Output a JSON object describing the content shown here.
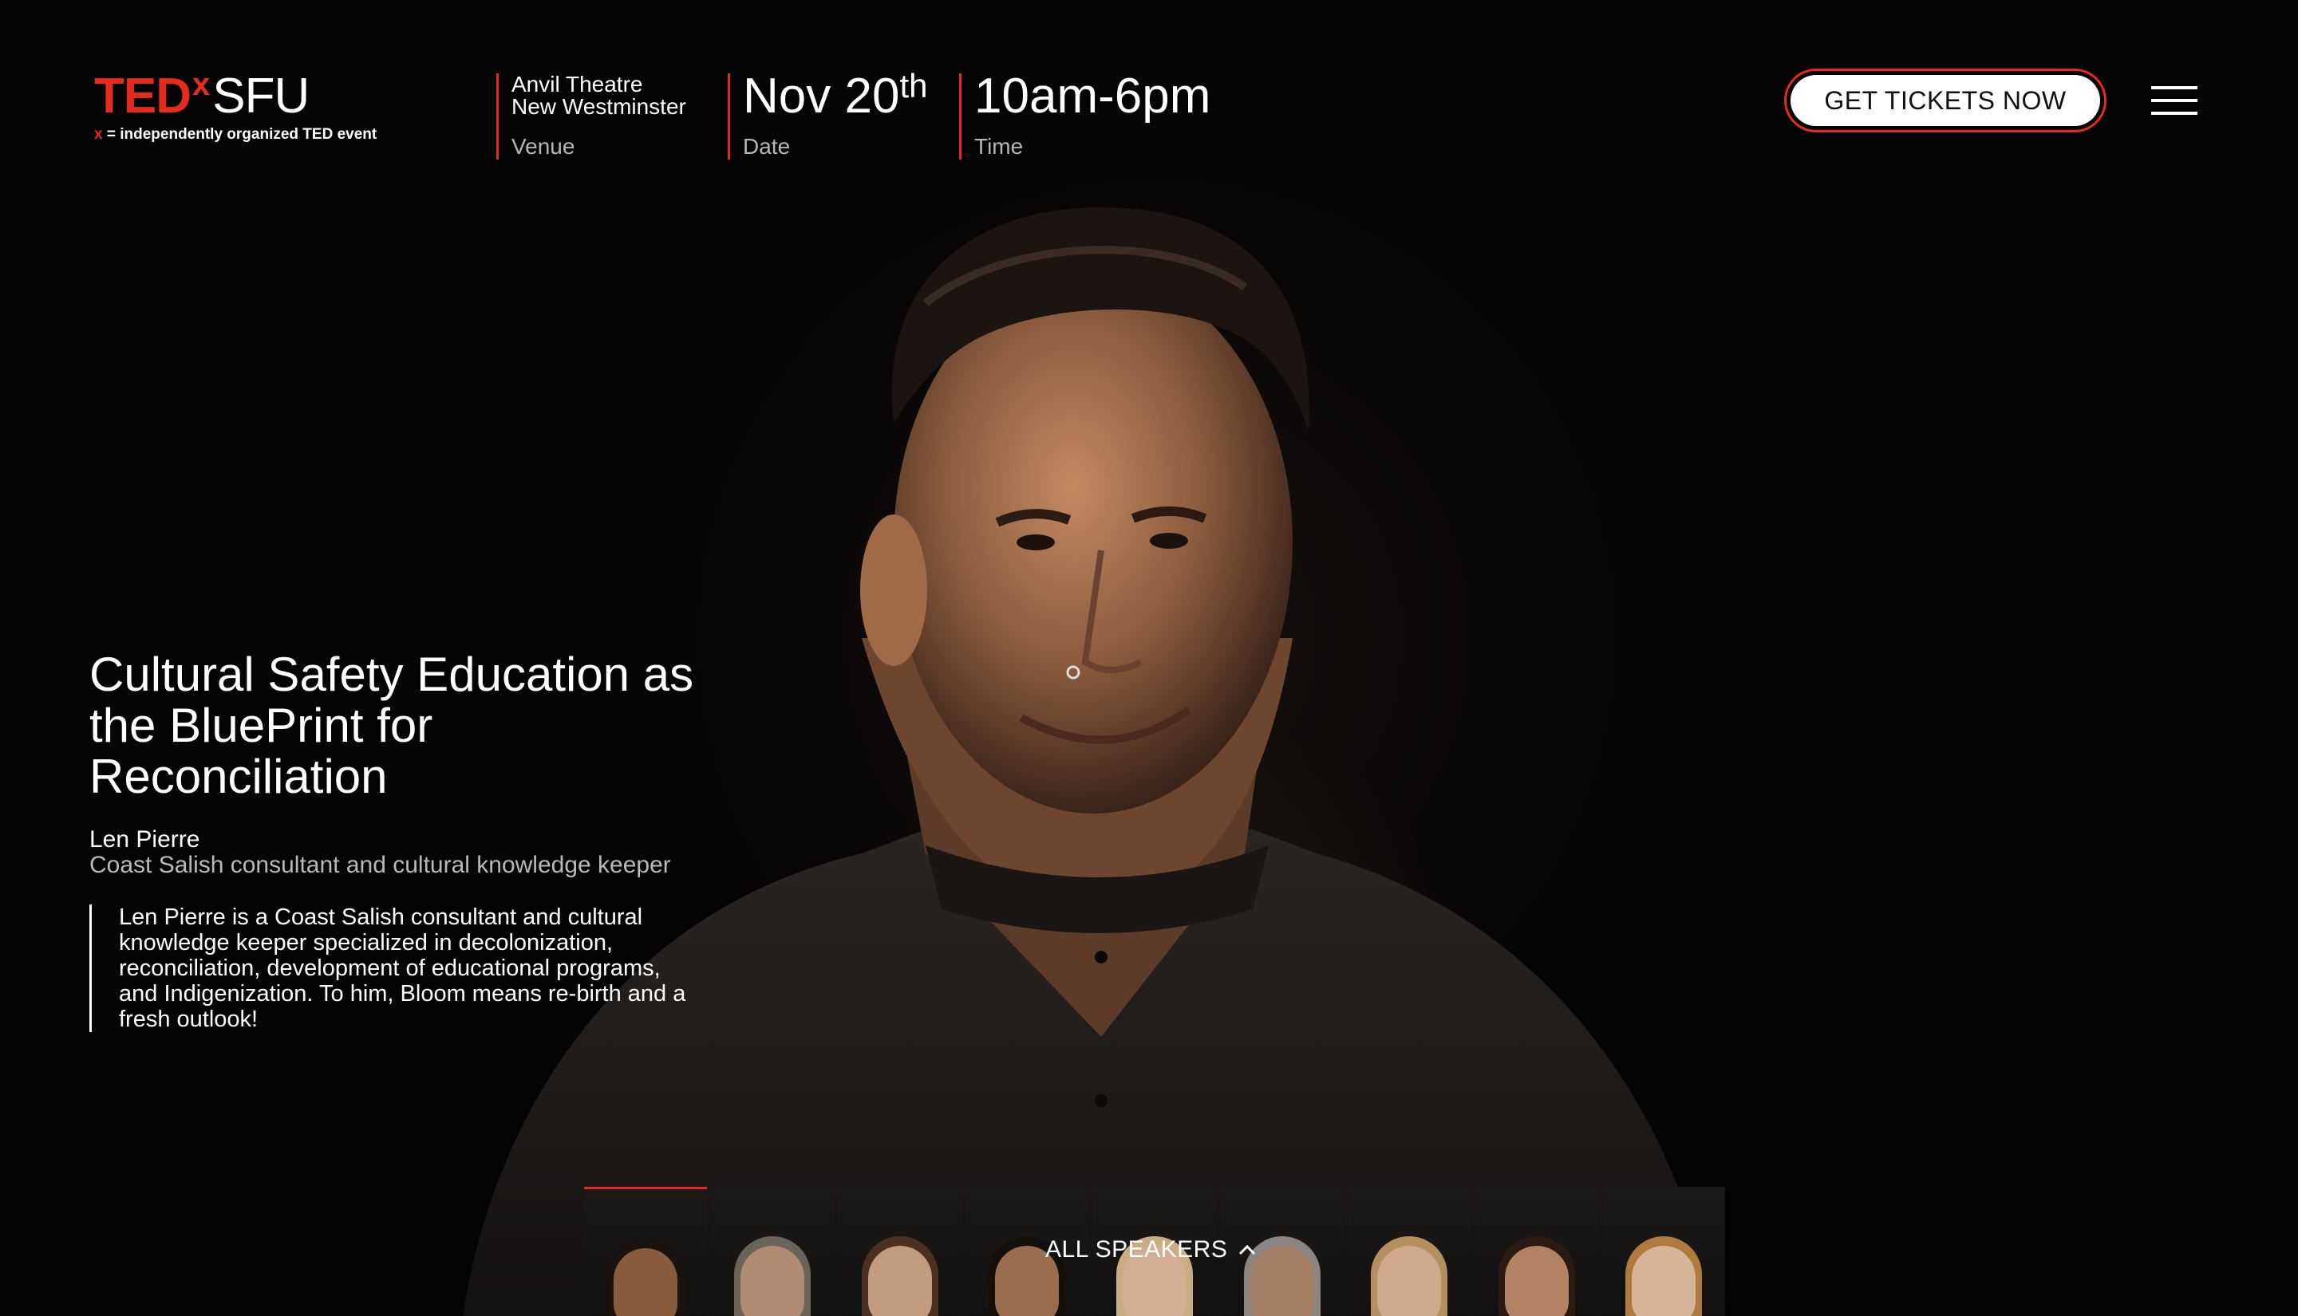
{
  "header": {
    "logo": {
      "ted": "TED",
      "x": "x",
      "org": "SFU",
      "tagline_prefix": "x",
      "tagline": " = independently organized TED event"
    },
    "venue": {
      "line1": "Anvil Theatre",
      "line2": "New Westminster",
      "label": "Venue"
    },
    "date": {
      "value": "Nov 20",
      "suffix": "th",
      "label": "Date"
    },
    "time": {
      "value": "10am-6pm",
      "label": "Time"
    },
    "cta": "GET TICKETS NOW",
    "menu_icon": "hamburger-menu-icon"
  },
  "talk": {
    "title": "Cultural Safety Education as the BluePrint for Reconciliation",
    "speaker_name": "Len Pierre",
    "speaker_role": "Coast Salish consultant and cultural knowledge keeper",
    "bio": "Len Pierre is a Coast Salish consultant and cultural knowledge keeper specialized in decolonization, reconciliation, development of educational programs, and Indigenization. To him, Bloom means re-birth and a fresh outlook!"
  },
  "speakers_strip": {
    "label": "ALL SPEAKERS",
    "toggle_icon": "chevron-up-icon",
    "thumbnail_count": 9,
    "active_index": 0
  },
  "colors": {
    "accent": "#e62b1e",
    "background": "#050404",
    "text": "#ffffff",
    "muted": "#bdb8b6"
  }
}
